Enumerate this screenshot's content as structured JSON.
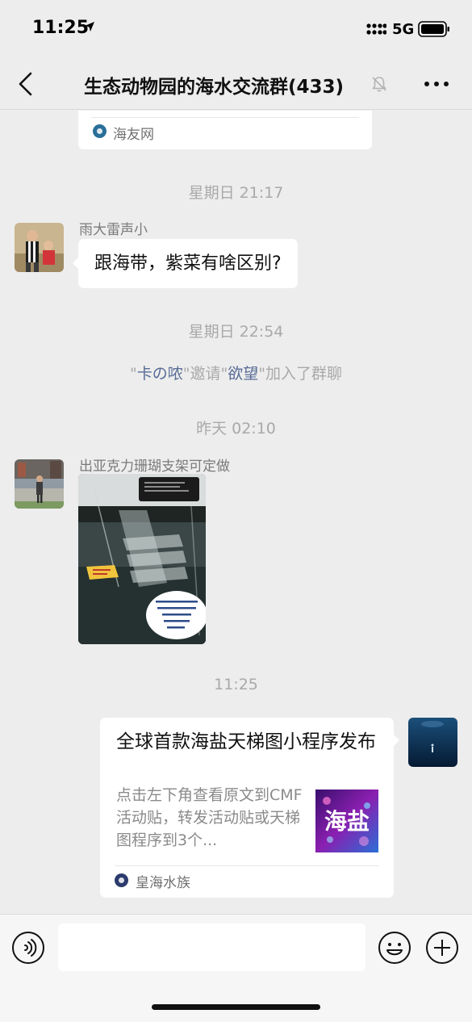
{
  "status_bar": {
    "time": "11:25",
    "network": "5G"
  },
  "header": {
    "title": "生态动物园的海水交流群(433)"
  },
  "chat": {
    "top_card": {
      "source": "海友网"
    },
    "timestamps": [
      "星期日 21:17",
      "星期日 22:54",
      "昨天 02:10",
      "11:25"
    ],
    "messages": [
      {
        "sender": "雨大雷声小",
        "text": "跟海带，紫菜有啥区别?"
      },
      {
        "sender": "出亚克力珊瑚支架可定做"
      }
    ],
    "system": {
      "quote1": "\"",
      "inviter": "卡の哝",
      "mid": "\"邀请\"",
      "invitee": "欲望",
      "end": "\"加入了群聊"
    },
    "link_card": {
      "title": "全球首款海盐天梯图小程序发布",
      "description": "点击左下角查看原文到CMF活动贴，转发活动贴或天梯图程序到3个...",
      "thumb_text": "海盐",
      "source": "皇海水族"
    }
  },
  "colors": {
    "background": "#ededed",
    "bubble": "#ffffff",
    "link_name": "#576b95",
    "system_text": "#a9a9a9"
  }
}
